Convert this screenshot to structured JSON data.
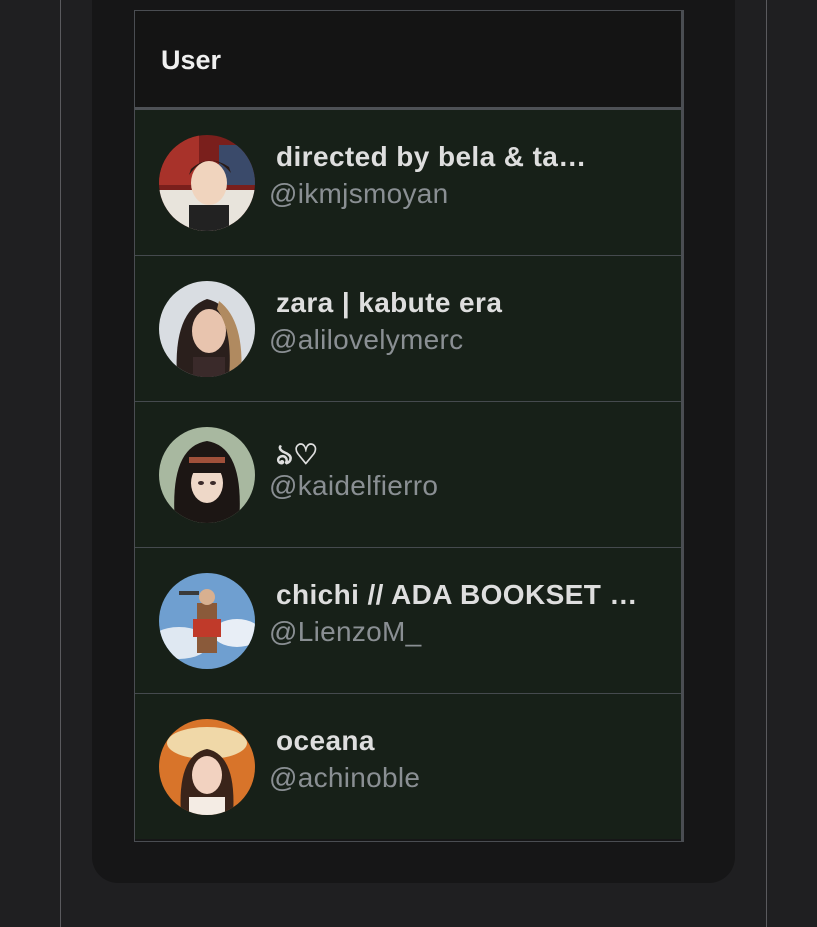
{
  "table": {
    "header": {
      "user": "User"
    },
    "rows": [
      {
        "name": "directed by bela & ta…",
        "handle": "@ikmjsmoyan",
        "avatar_icon": "avatar-photo-boy-red-background"
      },
      {
        "name": "zara | kabute era",
        "handle": "@alilovelymerc",
        "avatar_icon": "avatar-photo-girl-long-hair"
      },
      {
        "name": "ঌ♡",
        "handle": "@kaidelfierro",
        "avatar_icon": "avatar-illustration-girl-bangs"
      },
      {
        "name": "chichi // ADA BOOKSET …",
        "handle": "@LienzoM_",
        "avatar_icon": "avatar-figure-blue-sky"
      },
      {
        "name": "oceana",
        "handle": "@achinoble",
        "avatar_icon": "avatar-photo-girl-hat-orange"
      }
    ]
  },
  "colors": {
    "page_background": "#1f1f21",
    "card_background": "#161617",
    "header_background": "#141414",
    "row_background": "#172018",
    "grid_line": "#4a4d52",
    "name_text": "#dedede",
    "handle_text": "#8a8f93"
  }
}
